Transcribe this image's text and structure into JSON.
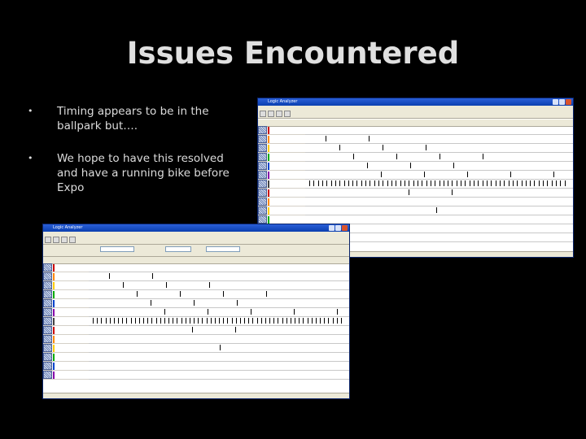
{
  "slide": {
    "title": "Issues Encountered",
    "bullets": [
      "Timing appears to be in the ballpark but….",
      "We hope to have this resolved and have a running bike before Expo"
    ]
  },
  "windows": [
    {
      "title": "Logic Analyzer",
      "signals": [
        "Ch 1",
        "Ch 2",
        "Ch 3",
        "Ch 4",
        "Ch 5",
        "Ch 6",
        "Ch 7",
        "Ch 8",
        "Ch 9",
        "Ch 10",
        "Ch 11",
        "Ch 12",
        "Ch 13"
      ]
    },
    {
      "title": "Logic Analyzer",
      "signals": [
        "Ch 1",
        "Ch 2",
        "Ch 3",
        "Ch 4",
        "Ch 5",
        "Ch 6",
        "Ch 7",
        "Ch 8",
        "Ch 9",
        "Ch 10",
        "Ch 11",
        "Ch 12",
        "Ch 13"
      ]
    }
  ],
  "colors": {
    "background": "#000000",
    "title_text": "#e0e0e0",
    "window_title_bar": "#0a3fb0",
    "channel_colors": [
      "#cc0000",
      "#ff8800",
      "#ffcc00",
      "#00aa00",
      "#0044cc",
      "#8800aa",
      "#444444",
      "#cc0000",
      "#ff8800",
      "#ffcc00",
      "#00aa00",
      "#0044cc",
      "#8800aa"
    ]
  }
}
